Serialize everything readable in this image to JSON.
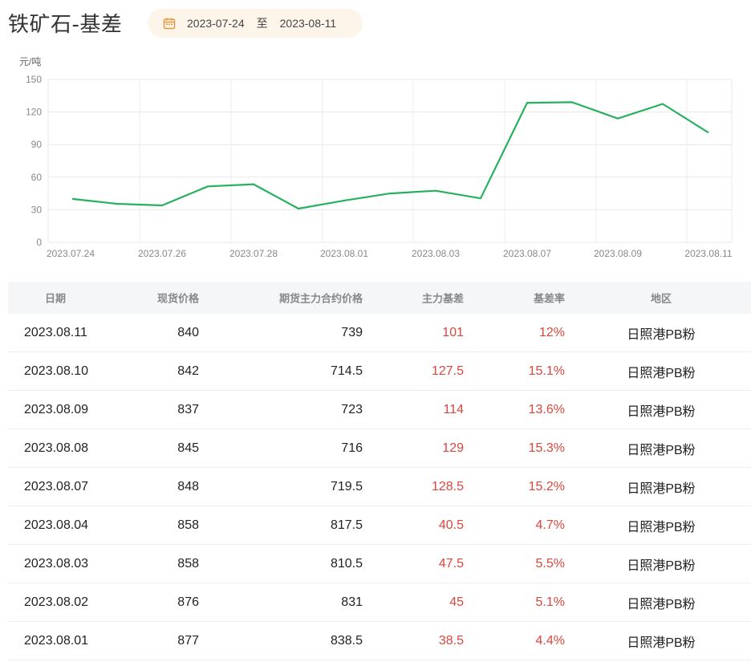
{
  "title": "铁矿石-基差",
  "date_range": {
    "start": "2023-07-24",
    "separator": "至",
    "end": "2023-08-11",
    "icon": "calendar-icon"
  },
  "chart_data": {
    "type": "line",
    "ylabel": "元/吨",
    "ylim": [
      0,
      150
    ],
    "yticks": [
      0,
      30,
      60,
      90,
      120,
      150
    ],
    "x": [
      "2023.07.24",
      "2023.07.25",
      "2023.07.26",
      "2023.07.27",
      "2023.07.28",
      "2023.07.31",
      "2023.08.01",
      "2023.08.02",
      "2023.08.03",
      "2023.08.04",
      "2023.08.07",
      "2023.08.08",
      "2023.08.09",
      "2023.08.10",
      "2023.08.11"
    ],
    "xtick_labels": [
      "2023.07.24",
      "2023.07.26",
      "2023.07.28",
      "2023.08.01",
      "2023.08.03",
      "2023.08.07",
      "2023.08.09",
      "2023.08.11"
    ],
    "series": [
      {
        "values": [
          40,
          35.5,
          34,
          51.5,
          53.5,
          31,
          38.5,
          45,
          47.5,
          40.5,
          128.5,
          129,
          114,
          127.5,
          101
        ],
        "color": "#27b15f"
      }
    ],
    "grid": true
  },
  "table": {
    "headers": [
      "日期",
      "现货价格",
      "期货主力合约价格",
      "主力基差",
      "基差率",
      "地区"
    ],
    "rows": [
      [
        "2023.08.11",
        "840",
        "739",
        "101",
        "12%",
        "日照港PB粉"
      ],
      [
        "2023.08.10",
        "842",
        "714.5",
        "127.5",
        "15.1%",
        "日照港PB粉"
      ],
      [
        "2023.08.09",
        "837",
        "723",
        "114",
        "13.6%",
        "日照港PB粉"
      ],
      [
        "2023.08.08",
        "845",
        "716",
        "129",
        "15.3%",
        "日照港PB粉"
      ],
      [
        "2023.08.07",
        "848",
        "719.5",
        "128.5",
        "15.2%",
        "日照港PB粉"
      ],
      [
        "2023.08.04",
        "858",
        "817.5",
        "40.5",
        "4.7%",
        "日照港PB粉"
      ],
      [
        "2023.08.03",
        "858",
        "810.5",
        "47.5",
        "5.5%",
        "日照港PB粉"
      ],
      [
        "2023.08.02",
        "876",
        "831",
        "45",
        "5.1%",
        "日照港PB粉"
      ],
      [
        "2023.08.01",
        "877",
        "838.5",
        "38.5",
        "4.4%",
        "日照港PB粉"
      ]
    ],
    "highlight_color": "#d9463d"
  }
}
